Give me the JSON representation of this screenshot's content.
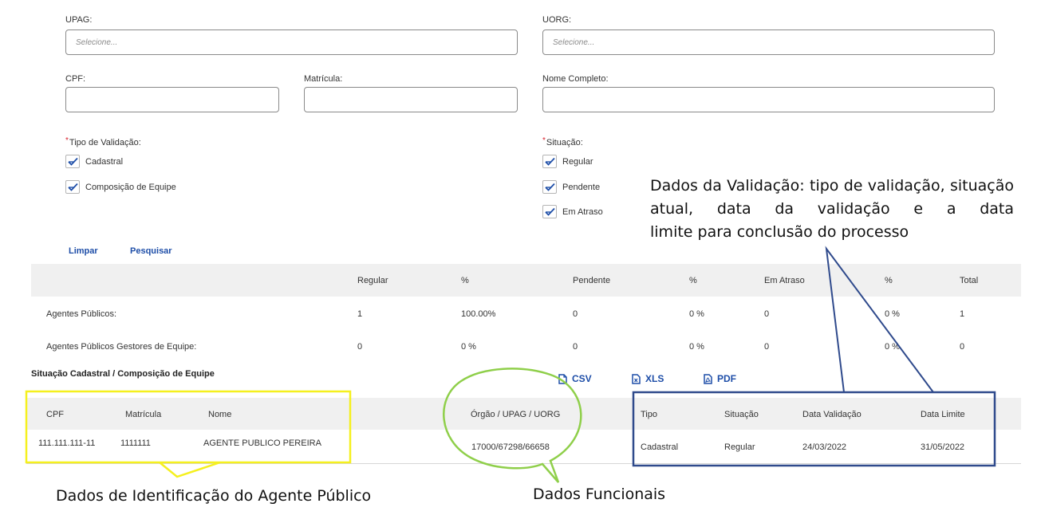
{
  "filters": {
    "upag": {
      "label": "UPAG:",
      "placeholder": "Selecione..."
    },
    "uorg": {
      "label": "UORG:",
      "placeholder": "Selecione..."
    },
    "cpf": {
      "label": "CPF:",
      "value": ""
    },
    "matricula": {
      "label": "Matrícula:",
      "value": ""
    },
    "nome": {
      "label": "Nome Completo:",
      "value": ""
    },
    "tipo_validacao": {
      "required_mark": "*",
      "label": "Tipo de Validação:",
      "options": [
        {
          "label": "Cadastral",
          "checked": true
        },
        {
          "label": "Composição de Equipe",
          "checked": true
        }
      ]
    },
    "situacao": {
      "required_mark": "*",
      "label": "Situação:",
      "options": [
        {
          "label": "Regular",
          "checked": true
        },
        {
          "label": "Pendente",
          "checked": true
        },
        {
          "label": "Em Atraso",
          "checked": true
        }
      ]
    }
  },
  "actions": {
    "clear": "Limpar",
    "search": "Pesquisar"
  },
  "summary": {
    "headers": [
      "Regular",
      "%",
      "Pendente",
      "%",
      "Em Atraso",
      "%",
      "Total"
    ],
    "rows": [
      {
        "label": "Agentes Públicos:",
        "values": [
          "1",
          "100.00%",
          "0",
          "0 %",
          "0",
          "0 %",
          "1"
        ]
      },
      {
        "label": "Agentes Públicos Gestores de Equipe:",
        "values": [
          "0",
          "0 %",
          "0",
          "0 %",
          "0",
          "0 %",
          "0"
        ]
      }
    ]
  },
  "results": {
    "title": "Situação Cadastral / Composição de Equipe",
    "exports": [
      "CSV",
      "XLS",
      "PDF"
    ],
    "headers": [
      "CPF",
      "Matrícula",
      "Nome",
      "Órgão / UPAG / UORG",
      "Tipo",
      "Situação",
      "Data Validação",
      "Data Limite"
    ],
    "rows": [
      [
        "111.111.111-11",
        "1111111",
        "AGENTE PUBLICO PEREIRA",
        "17000/67298/66658",
        "Cadastral",
        "Regular",
        "24/03/2022",
        "31/05/2022"
      ]
    ]
  },
  "annotations": {
    "validation": "Dados da Validação: tipo de validação, situação atual,  data da validação e a data",
    "validation_last": "limite para conclusão do processo",
    "identification": "Dados de Identificação do Agente Público",
    "functional": "Dados Funcionais"
  },
  "colors": {
    "accent": "#1e4ea8",
    "annotation_yellow": "#f5f01e",
    "annotation_green": "#8fcf4a",
    "annotation_blue": "#2f4a8c",
    "header_bg": "#f0f0f0"
  }
}
